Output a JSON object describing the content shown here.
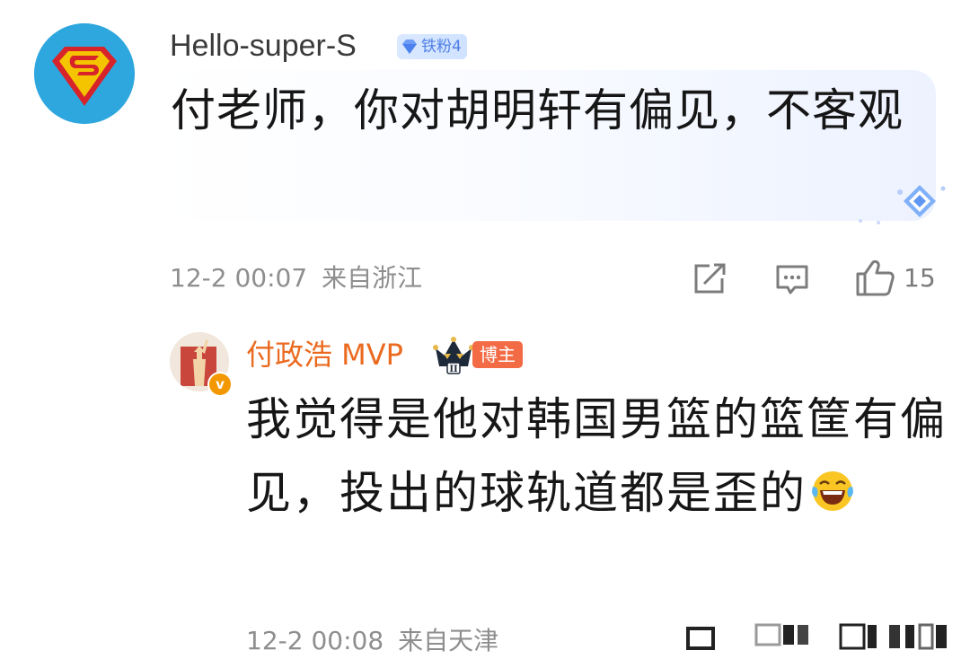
{
  "comment": {
    "username": "Hello-super-S",
    "fan_badge": "铁粉4",
    "text": "付老师，你对胡明轩有偏见，不客观",
    "timestamp": "12-2 00:07",
    "location": "来自浙江",
    "like_count": "15",
    "icons": {
      "avatar": "superman-logo-avatar",
      "badge": "diamond-icon",
      "share": "share-icon",
      "reply": "comment-icon",
      "like": "thumbs-up-icon",
      "decoration": "diamond-sparkle-icon"
    }
  },
  "reply": {
    "username": "付政浩 MVP",
    "crown_level": "II",
    "verified_mark": "v",
    "role_badge": "博主",
    "text": "我觉得是他对韩国男篮的篮筐有偏见，投出的球轨道都是歪的",
    "emoji": "laughing-tears-emoji",
    "timestamp": "12-2 00:08",
    "location": "来自天津",
    "icons": {
      "avatar": "statue-of-liberty-avatar",
      "crown": "crown-icon"
    }
  },
  "colors": {
    "reply_username": "#ea6a1f",
    "badge_blue": "#4f7fe6",
    "blogger_badge": "#f26b45",
    "meta_gray": "#8e8e8e",
    "avatar1_bg": "#2ea7de"
  }
}
